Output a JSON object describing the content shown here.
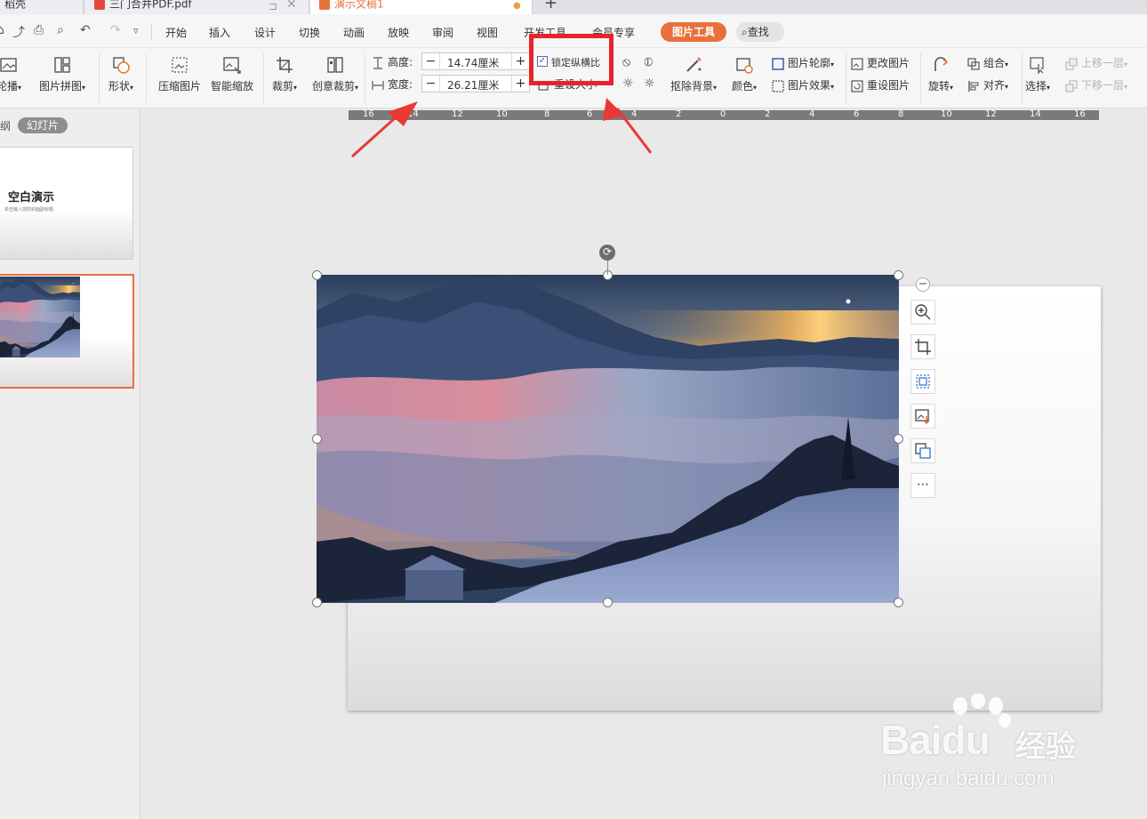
{
  "tabs": [
    {
      "label": "稻壳",
      "icon": "docer-icon"
    },
    {
      "label": "三门合并PDF.pdf",
      "icon": "pdf-icon"
    },
    {
      "label": "演示文稿1",
      "icon": "presentation-icon"
    }
  ],
  "menu": {
    "items": [
      "开始",
      "插入",
      "设计",
      "切换",
      "动画",
      "放映",
      "审阅",
      "视图",
      "开发工具",
      "会员专享"
    ],
    "picture_tools": "图片工具",
    "search": "查找"
  },
  "ribbon": {
    "carousel": "轮播",
    "collage": "图片拼图",
    "shape": "形状",
    "compress": "压缩图片",
    "smart_zoom": "智能缩放",
    "crop": "裁剪",
    "creative_crop": "创意裁剪",
    "height_label": "高度:",
    "height_value": "14.74厘米",
    "width_label": "宽度:",
    "width_value": "26.21厘米",
    "lock_ratio": "锁定纵横比",
    "reset_size": "重设大小",
    "remove_bg": "抠除背景",
    "color": "颜色",
    "outline": "图片轮廓",
    "effects": "图片效果",
    "change_pic": "更改图片",
    "reset_pic": "重设图片",
    "rotate": "旋转",
    "group": "组合",
    "align": "对齐",
    "select": "选择",
    "bring_forward": "上移一层",
    "send_backward": "下移一层",
    "lock_ratio_checked": true
  },
  "sidebar": {
    "outline_tab": "大纲",
    "slides_tab": "幻灯片",
    "slide1_title": "空白演示",
    "slide1_subtitle": "单击输入您的封面副标题"
  },
  "ruler_labels": [
    "16",
    "14",
    "12",
    "10",
    "8",
    "6",
    "4",
    "2",
    "0",
    "2",
    "4",
    "6",
    "8",
    "10",
    "12",
    "14",
    "16"
  ],
  "watermark": {
    "logo_bai": "Bai",
    "logo_du": "du",
    "logo_cn": "经验",
    "url": "jingyan.baidu.com"
  },
  "colors": {
    "accent": "#e8703a",
    "highlight": "#e8232a",
    "arrow": "#e83a35"
  }
}
